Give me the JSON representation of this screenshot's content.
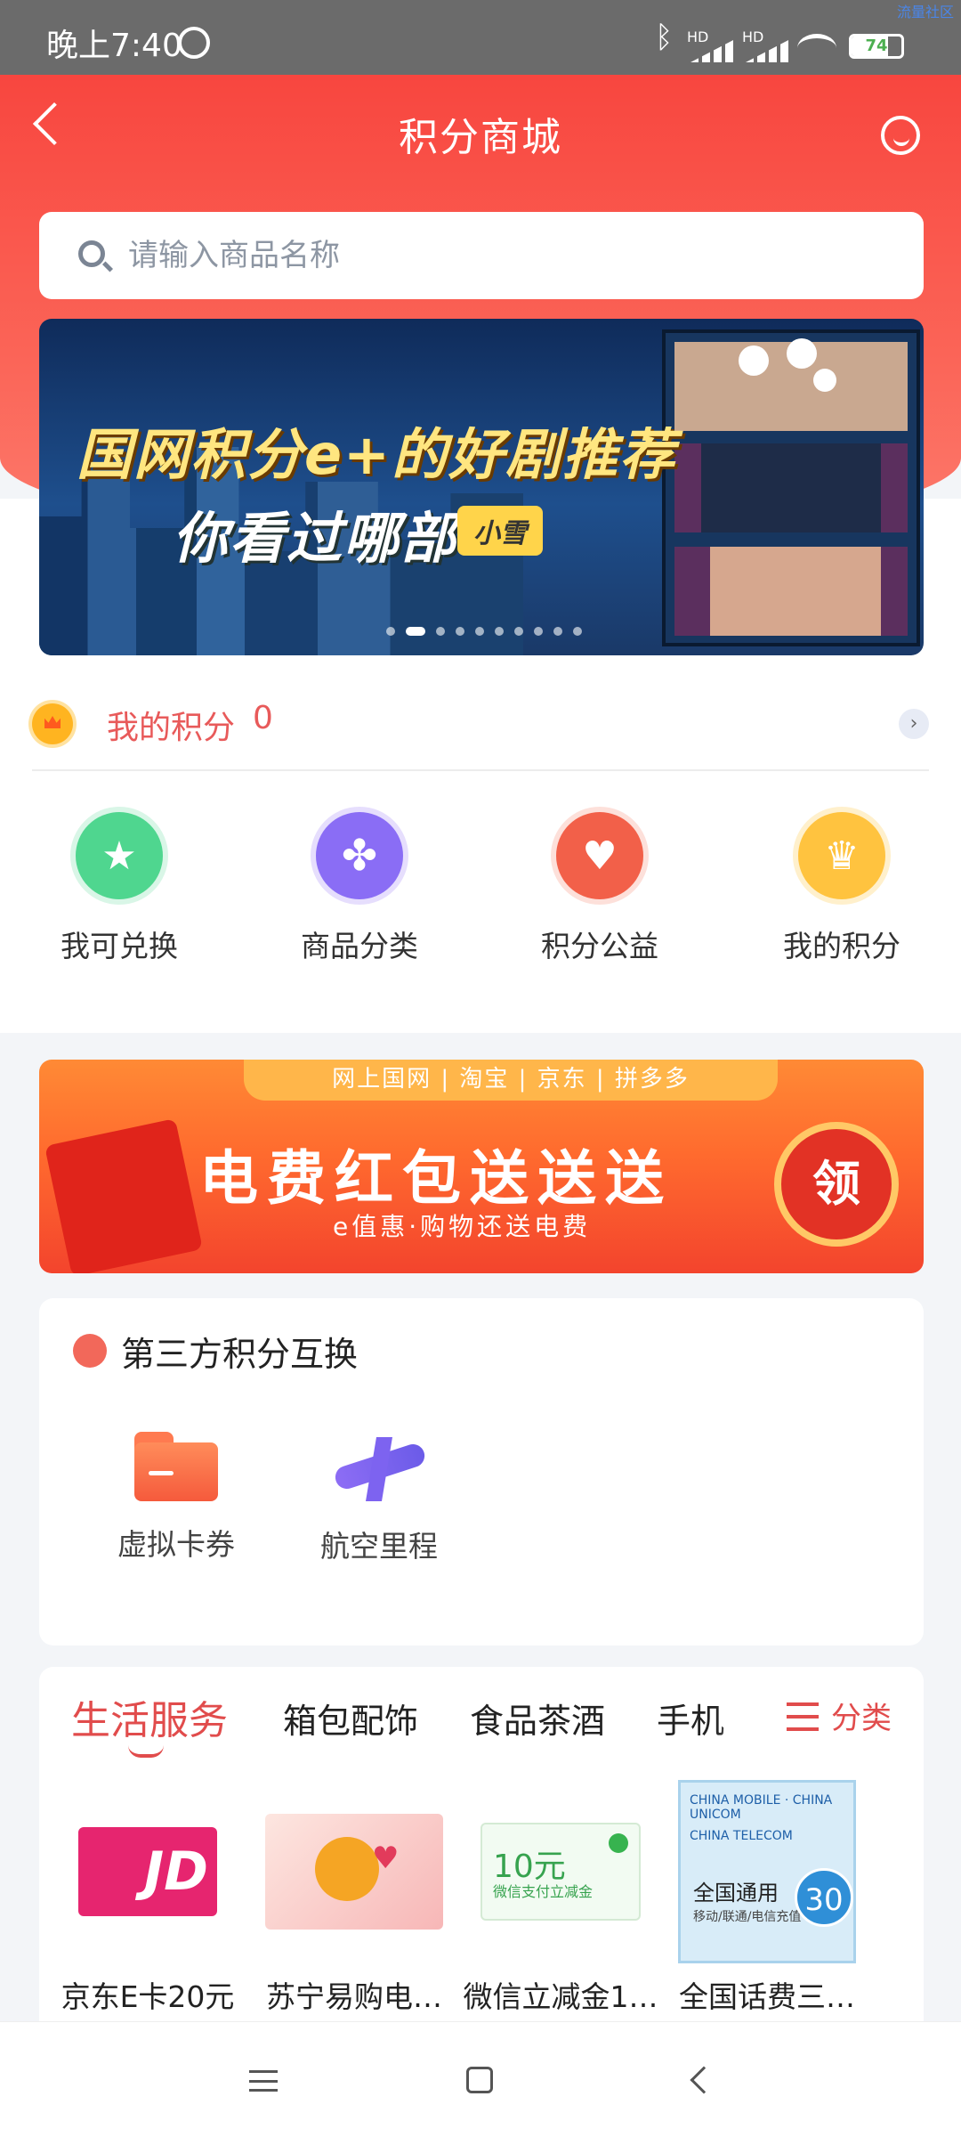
{
  "status_bar": {
    "time": "晚上7:40",
    "network_labels": [
      "HD",
      "HD"
    ],
    "battery": "74",
    "battery_level": 0.74
  },
  "corner_text": "流量社区",
  "header": {
    "title": "积分商城"
  },
  "search": {
    "placeholder": "请输入商品名称"
  },
  "banner": {
    "line1": "国网积分e+的好剧推荐",
    "line2": "你看过哪部",
    "tag": "小雪",
    "slide_count": 10,
    "active_index": 1
  },
  "points": {
    "label": "我的积分",
    "value": "0"
  },
  "quick_links": [
    {
      "label": "我可兑换",
      "icon": "star-icon",
      "color": "#4fd68f"
    },
    {
      "label": "商品分类",
      "icon": "grid-icon",
      "color": "#8a6df5"
    },
    {
      "label": "积分公益",
      "icon": "heart-icon",
      "color": "#f26049"
    },
    {
      "label": "我的积分",
      "icon": "crown-icon",
      "color": "#ffc33f"
    }
  ],
  "promo": {
    "platforms": "网上国网 | 淘宝 | 京东 | 拼多多",
    "title": "电费红包送送送",
    "subtitle": "e值惠·购物还送电费",
    "button": "领"
  },
  "exchange": {
    "title": "第三方积分互换",
    "items": [
      {
        "label": "虚拟卡券",
        "icon": "folder-icon"
      },
      {
        "label": "航空里程",
        "icon": "airplane-icon"
      }
    ]
  },
  "categories": {
    "tabs": [
      "生活服务",
      "箱包配饰",
      "食品茶酒",
      "手机"
    ],
    "active": 0,
    "more_label": "分类"
  },
  "products": [
    {
      "name": "京东E卡20元",
      "image": "jd-card"
    },
    {
      "name": "苏宁易购电…",
      "image": "suning-card"
    },
    {
      "name": "微信立减金1…",
      "image": "wechat-coupon",
      "amount": "10元",
      "desc": "微信支付立减金"
    },
    {
      "name": "全国话费三…",
      "image": "phone-credit",
      "amount": "30",
      "text": "全国通用",
      "sub": "移动/联通/电信充值"
    }
  ]
}
